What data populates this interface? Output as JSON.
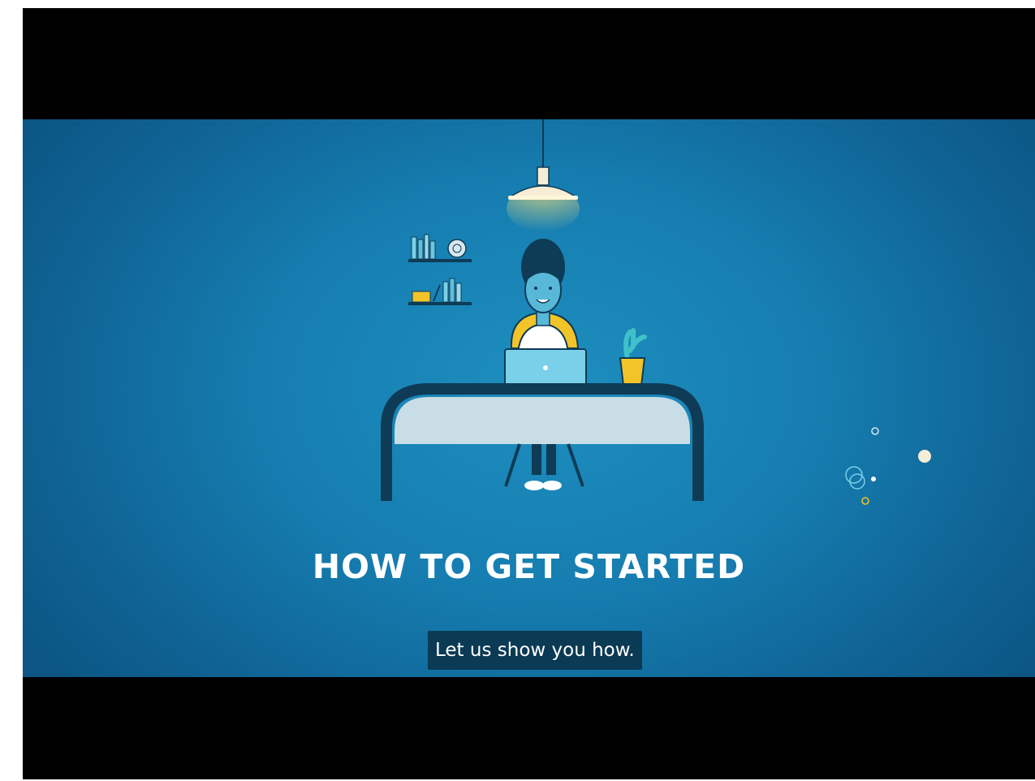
{
  "video": {
    "title": "HOW TO GET STARTED",
    "caption": "Let us show you how."
  },
  "illustration": {
    "subject": "woman-at-desk-with-laptop",
    "elements": [
      "ceiling-lamp",
      "bookshelf",
      "laptop",
      "cactus-plant",
      "desk",
      "chair",
      "floating-dots"
    ]
  },
  "colors": {
    "background": "#167db0",
    "caption_bg": "#0b3a55",
    "title_text": "#ffffff",
    "lamp_glow": "#f3d66a",
    "plant_pot": "#f2c42a",
    "desk_top": "#c9dde7",
    "desk_frame": "#0e3b56"
  }
}
